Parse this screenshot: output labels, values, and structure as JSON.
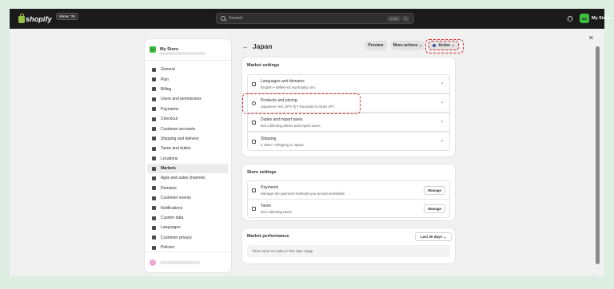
{
  "topbar": {
    "logo": "shopify",
    "edition": "Winter '25",
    "search_placeholder": "Search",
    "shortcut_key1": "CTRL",
    "shortcut_key2": "K",
    "store_avatar": "MS",
    "store_name": "My Store"
  },
  "nav": {
    "store_name": "My Store",
    "store_avatar": "MS",
    "items": [
      {
        "label": "General",
        "icon": "store-icon"
      },
      {
        "label": "Plan",
        "icon": "plan-icon"
      },
      {
        "label": "Billing",
        "icon": "billing-icon"
      },
      {
        "label": "Users and permissions",
        "icon": "users-icon"
      },
      {
        "label": "Payments",
        "icon": "payments-icon"
      },
      {
        "label": "Checkout",
        "icon": "checkout-icon"
      },
      {
        "label": "Customer accounts",
        "icon": "customer-accounts-icon"
      },
      {
        "label": "Shipping and delivery",
        "icon": "truck-icon"
      },
      {
        "label": "Taxes and duties",
        "icon": "taxes-icon"
      },
      {
        "label": "Locations",
        "icon": "location-icon"
      },
      {
        "label": "Markets",
        "icon": "globe-icon"
      },
      {
        "label": "Apps and sales channels",
        "icon": "apps-icon"
      },
      {
        "label": "Domains",
        "icon": "domains-icon"
      },
      {
        "label": "Customer events",
        "icon": "events-icon"
      },
      {
        "label": "Notifications",
        "icon": "bell-icon"
      },
      {
        "label": "Custom data",
        "icon": "data-icon"
      },
      {
        "label": "Languages",
        "icon": "languages-icon"
      },
      {
        "label": "Customer privacy",
        "icon": "lock-icon"
      },
      {
        "label": "Policies",
        "icon": "policies-icon"
      }
    ],
    "active_index": 10
  },
  "page": {
    "title": "Japan",
    "preview_label": "Preview",
    "more_actions_label": "More actions",
    "status_label": "Active"
  },
  "market_settings": {
    "title": "Market settings",
    "rows": [
      {
        "title": "Languages and domains",
        "subtitle": "English • s9lfe6-x0.myshopify.com"
      },
      {
        "title": "Products and pricing",
        "subtitle": "Japanese Yen (JPY ¥) • Rounded to ¥100 JPY"
      },
      {
        "title": "Duties and import taxes",
        "subtitle": "Not collecting duties and import taxes"
      },
      {
        "title": "Shipping",
        "subtitle": "2 rates • Shipping to Japan"
      }
    ]
  },
  "store_settings": {
    "title": "Store settings",
    "rows": [
      {
        "title": "Payments",
        "subtitle": "Manage the payment methods you accept worldwide.",
        "action": "Manage"
      },
      {
        "title": "Taxes",
        "subtitle": "Not collecting taxes",
        "action": "Manage"
      }
    ]
  },
  "performance": {
    "title": "Market performance",
    "range_label": "Last 30 days",
    "empty_text": "There were no sales in this date range"
  },
  "colors": {
    "highlight": "#d92a2a",
    "brand_green": "#95bf47",
    "active_dot": "#3e4ea8"
  }
}
